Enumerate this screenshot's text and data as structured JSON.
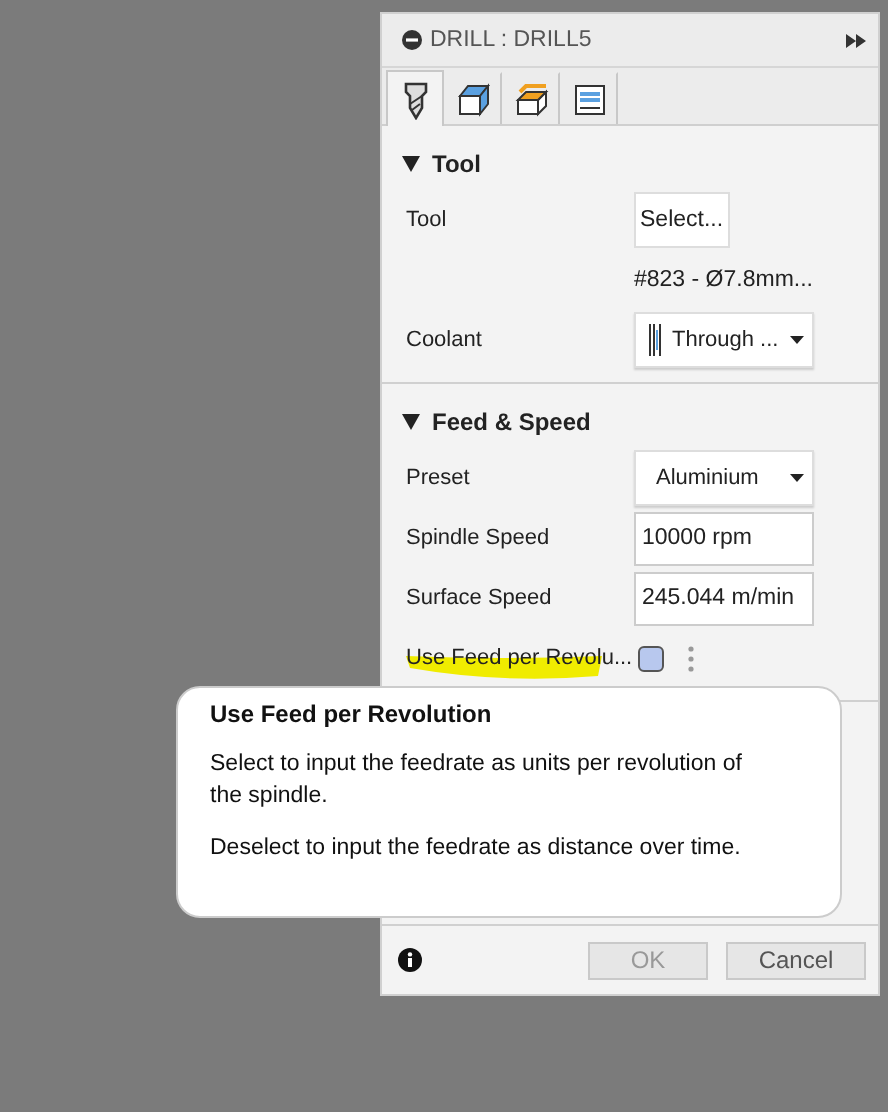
{
  "window": {
    "title": "DRILL : DRILL5"
  },
  "tabs": [
    {
      "kind": "tool",
      "selected": true
    },
    {
      "kind": "geometry",
      "selected": false
    },
    {
      "kind": "heights",
      "selected": false
    },
    {
      "kind": "passes",
      "selected": false
    }
  ],
  "sections": [
    {
      "title": "Tool",
      "expanded": true,
      "rows": [
        {
          "kind": "button",
          "label": "Tool",
          "value": "Select..."
        },
        {
          "kind": "note",
          "value": "#823 - Ø7.8mm..."
        },
        {
          "kind": "dropdown",
          "label": "Coolant",
          "value": "Through ...",
          "icon": true
        }
      ]
    },
    {
      "title": "Feed & Speed",
      "expanded": true,
      "rows": [
        {
          "kind": "dropdown",
          "label": "Preset",
          "value": "Aluminium",
          "icon": false
        },
        {
          "kind": "input",
          "label": "Spindle Speed",
          "value": "10000 rpm"
        },
        {
          "kind": "input",
          "label": "Surface Speed",
          "value": "245.044 m/min"
        },
        {
          "kind": "checkbox",
          "label": "Use Feed per Revolu...",
          "checked": false,
          "highlighted": true
        }
      ]
    }
  ],
  "tooltip": {
    "title": "Use Feed per Revolution",
    "paragraphs": [
      "Select to input the feedrate as units per revolution of the spindle.",
      "Deselect to input the feedrate as distance over time."
    ]
  },
  "buttons": [
    {
      "label": "OK",
      "disabled": true
    },
    {
      "label": "Cancel",
      "disabled": false
    }
  ]
}
